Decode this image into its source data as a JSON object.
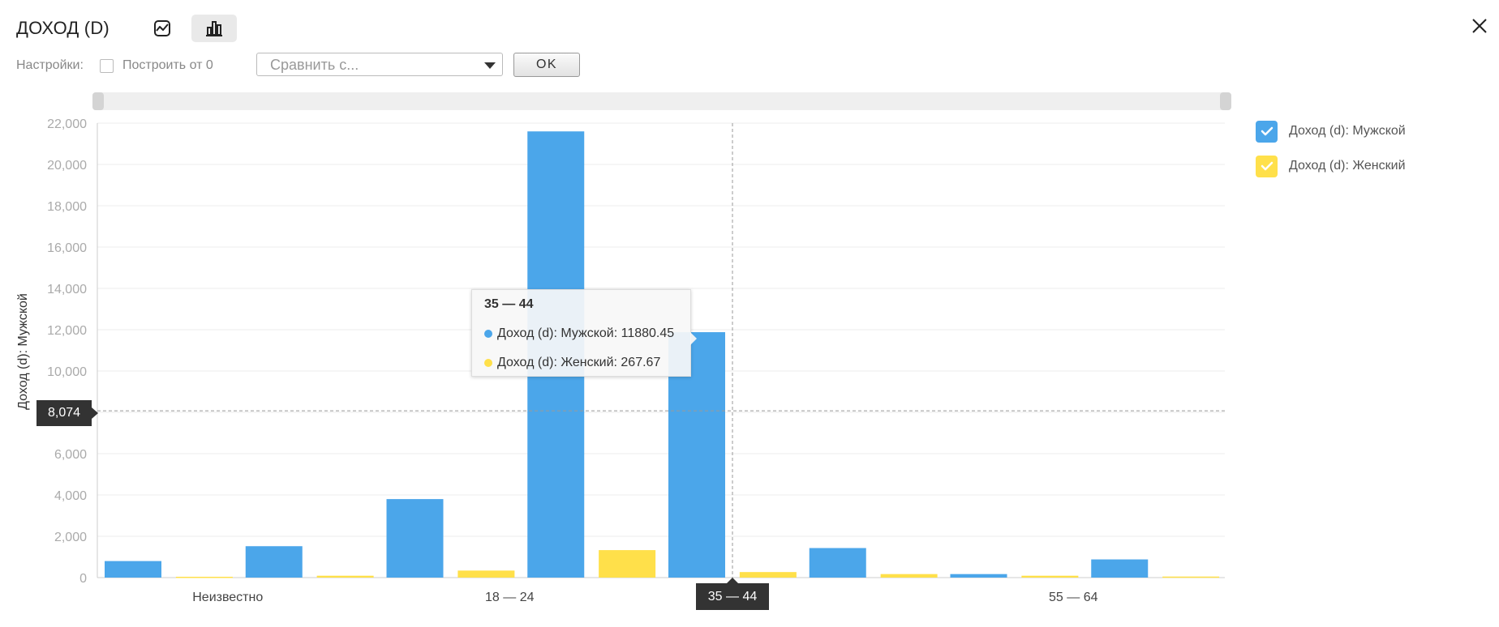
{
  "header": {
    "title": "ДОХОД (D)",
    "line_mode_icon": "line-chart-icon",
    "bar_mode_icon": "bar-chart-icon",
    "close_icon": "close-icon"
  },
  "settings": {
    "label": "Настройки:",
    "from_zero_label": "Построить от 0",
    "compare_placeholder": "Сравнить с...",
    "ok_label": "OK"
  },
  "colors": {
    "male": "#4ba6ea",
    "female": "#ffe04a",
    "grid": "#ececec",
    "axis": "#cccccc",
    "tick": "#aaaaaa"
  },
  "chart_data": {
    "type": "bar",
    "ylabel": "Доход (d): Мужской",
    "ylim": [
      0,
      22000
    ],
    "yticks": [
      0,
      2000,
      4000,
      6000,
      8000,
      10000,
      12000,
      14000,
      16000,
      18000,
      20000,
      22000
    ],
    "ytick_labels": [
      "0",
      "2,000",
      "4,000",
      "6,000",
      "8,000",
      "10,000",
      "12,000",
      "14,000",
      "16,000",
      "18,000",
      "20,000",
      "22,000"
    ],
    "categories": [
      "Неизвестно",
      "",
      "18 — 24",
      "",
      "35 — 44",
      "",
      "55 — 64",
      ""
    ],
    "series": [
      {
        "name": "Доход (d): Мужской",
        "values": [
          800,
          1520,
          3800,
          21600,
          11880.45,
          1430,
          170,
          880
        ]
      },
      {
        "name": "Доход (d): Женский",
        "values": [
          40,
          90,
          340,
          1330,
          267.67,
          170,
          90,
          50
        ]
      }
    ],
    "legend_position": "right",
    "grid": true
  },
  "crosshair": {
    "y_label": "8,074",
    "y_value": 8074,
    "x_label": "35 — 44",
    "x_category_index": 4
  },
  "tooltip": {
    "title": "35 — 44",
    "rows": [
      {
        "label": "Доход (d): Мужской: 11880.45"
      },
      {
        "label": "Доход (d): Женский: 267.67"
      }
    ]
  }
}
